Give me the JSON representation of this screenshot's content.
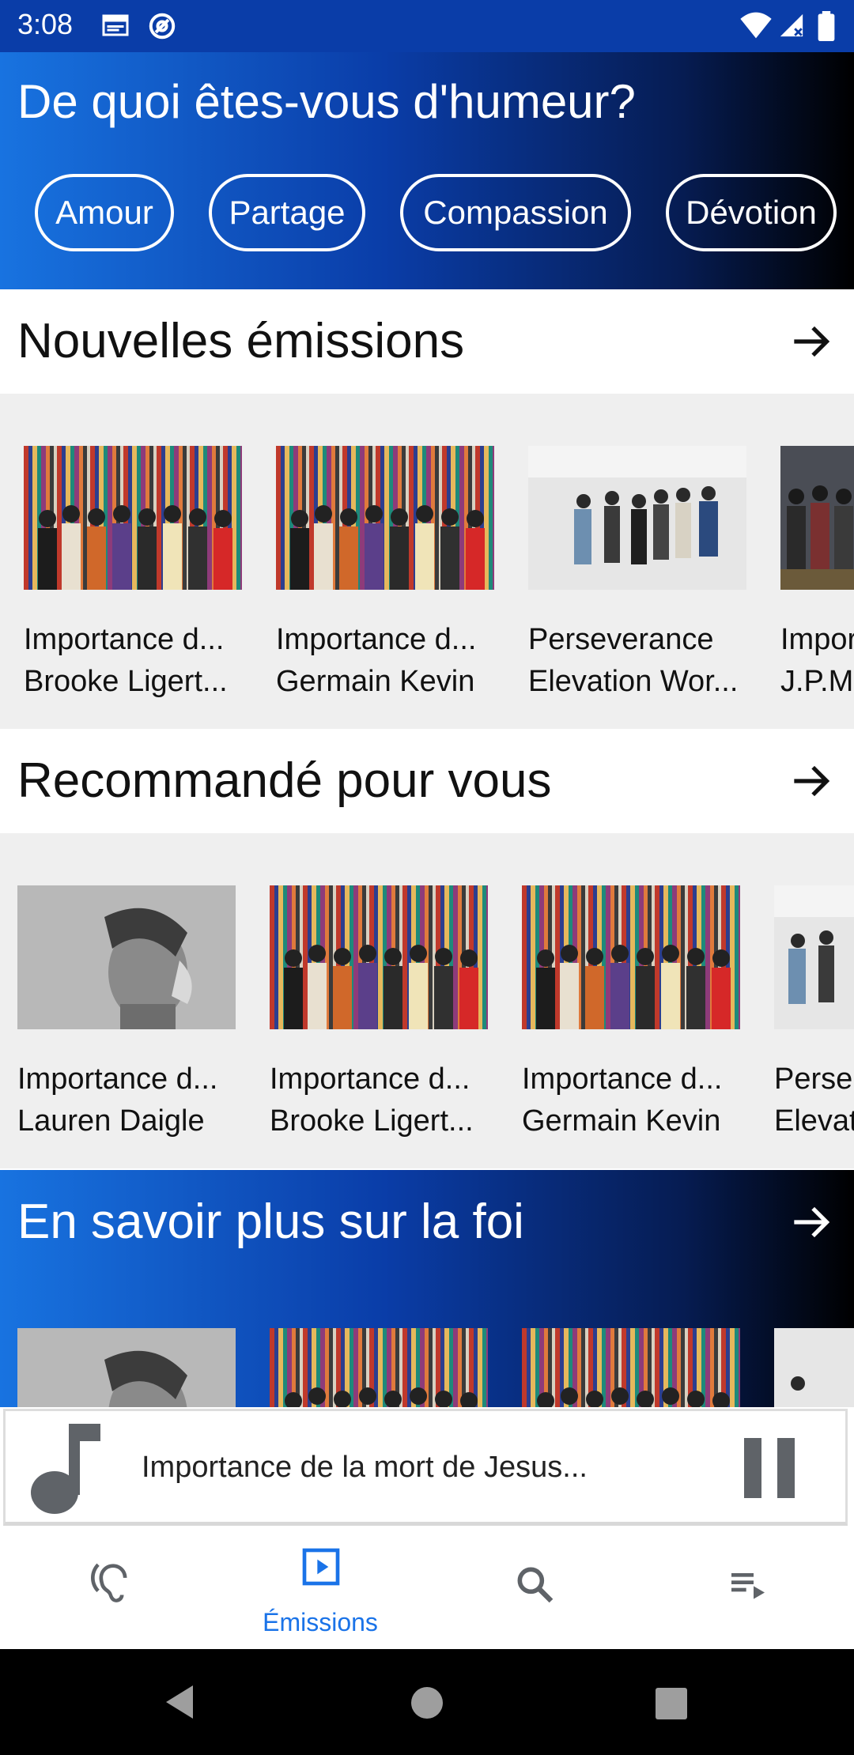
{
  "status_bar": {
    "time": "3:08"
  },
  "mood": {
    "title": "De quoi êtes-vous d'humeur?",
    "chips": [
      "Amour",
      "Partage",
      "Compassion",
      "Dévotion"
    ]
  },
  "sections": [
    {
      "title": "Nouvelles émissions",
      "cards": [
        {
          "line1": "Importance d...",
          "line2": "Brooke Ligert..."
        },
        {
          "line1": "Importance d...",
          "line2": "Germain Kevin"
        },
        {
          "line1": "Perseverance",
          "line2": "Elevation Wor..."
        },
        {
          "line1": "Impor",
          "line2": "J.P.M"
        }
      ]
    },
    {
      "title": "Recommandé pour vous",
      "cards": [
        {
          "line1": "Importance d...",
          "line2": "Lauren Daigle"
        },
        {
          "line1": "Importance d...",
          "line2": "Brooke Ligert..."
        },
        {
          "line1": "Importance d...",
          "line2": "Germain Kevin"
        },
        {
          "line1": "Perse",
          "line2": "Elevat"
        }
      ]
    }
  ],
  "faith": {
    "title": "En savoir plus sur la foi"
  },
  "player": {
    "title": "Importance de la mort de Jesus..."
  },
  "bottom_nav": {
    "items": [
      {
        "icon": "ear-icon",
        "label": ""
      },
      {
        "icon": "play-box-icon",
        "label": "Émissions"
      },
      {
        "icon": "search-icon",
        "label": ""
      },
      {
        "icon": "queue-icon",
        "label": ""
      }
    ],
    "active_index": 1
  },
  "colors": {
    "accent": "#1a73e8",
    "status_bar": "#0a3da8",
    "gradient_start": "#1873e0",
    "gradient_end": "#000000"
  }
}
